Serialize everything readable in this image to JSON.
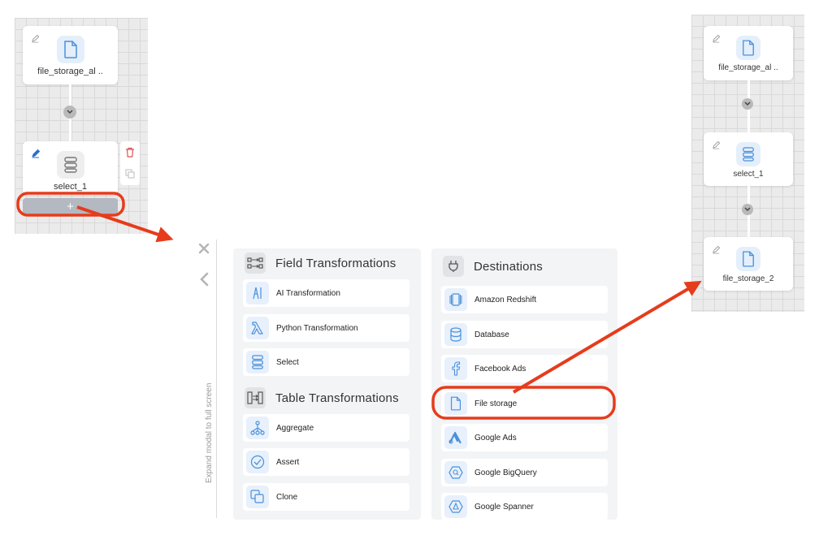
{
  "left_flow": {
    "node1_label": "file_storage_al ..",
    "node2_label": "select_1",
    "add_symbol": "+"
  },
  "right_flow": {
    "node1_label": "file_storage_al ..",
    "node2_label": "select_1",
    "node3_label": "file_storage_2"
  },
  "modal": {
    "expand_label": "Expand modal to full screen",
    "field_transformations": {
      "title": "Field Transformations",
      "items": [
        "AI Transformation",
        "Python Transformation",
        "Select"
      ]
    },
    "table_transformations": {
      "title": "Table Transformations",
      "items": [
        "Aggregate",
        "Assert",
        "Clone"
      ]
    },
    "destinations": {
      "title": "Destinations",
      "items": [
        "Amazon Redshift",
        "Database",
        "Facebook Ads",
        "File storage",
        "Google Ads",
        "Google BigQuery",
        "Google Spanner"
      ]
    }
  },
  "colors": {
    "highlight": "#e53c1c",
    "icon_blue": "#4a90d9",
    "delete_red": "#e05050"
  }
}
